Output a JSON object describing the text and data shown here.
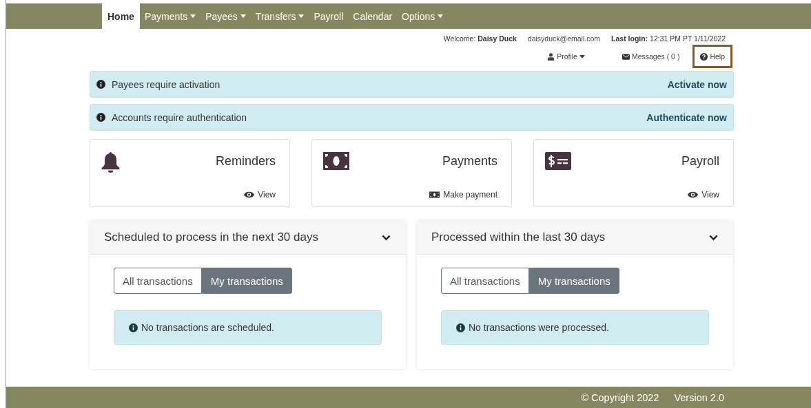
{
  "nav": [
    {
      "label": "Home",
      "selected": true,
      "dropdown": false
    },
    {
      "label": "Payments",
      "selected": false,
      "dropdown": true
    },
    {
      "label": "Payees",
      "selected": false,
      "dropdown": true
    },
    {
      "label": "Transfers",
      "selected": false,
      "dropdown": true
    },
    {
      "label": "Payroll",
      "selected": false,
      "dropdown": false
    },
    {
      "label": "Calendar",
      "selected": false,
      "dropdown": false
    },
    {
      "label": "Options",
      "selected": false,
      "dropdown": true
    }
  ],
  "user_info": {
    "welcome_label": "Welcome:",
    "user_name": "Daisy Duck",
    "email": "daisyduck@email.com",
    "last_login_label": "Last login:",
    "last_login": "12:31 PM PT 1/11/2022"
  },
  "user_menu": [
    {
      "kind": "profile",
      "label": "Profile",
      "dropdown": true,
      "selected": false
    },
    {
      "kind": "messages",
      "label": "Messages ( 0 )",
      "dropdown": false,
      "selected": false
    },
    {
      "kind": "help",
      "label": "Help",
      "dropdown": false,
      "selected": true
    }
  ],
  "alerts": [
    {
      "message": "Payees require activation",
      "action": "Activate now"
    },
    {
      "message": "Accounts require authentication",
      "action": "Authenticate now"
    }
  ],
  "cards": [
    {
      "kind": "bell",
      "title": "Reminders",
      "link": {
        "kind": "view",
        "label": "View"
      }
    },
    {
      "kind": "money",
      "title": "Payments",
      "link": {
        "kind": "money",
        "label": "Make payment"
      }
    },
    {
      "kind": "check",
      "title": "Payroll",
      "link": {
        "kind": "view",
        "label": "View"
      }
    }
  ],
  "panels": [
    {
      "title": "Scheduled to process in the next 30 days",
      "toggles": [
        {
          "label": "All transactions",
          "selected": false
        },
        {
          "label": "My transactions",
          "selected": true
        }
      ],
      "notice": "No transactions are scheduled."
    },
    {
      "title": "Processed within the last 30 days",
      "toggles": [
        {
          "label": "All transactions",
          "selected": false
        },
        {
          "label": "My transactions",
          "selected": true
        }
      ],
      "notice": "No transactions were processed."
    }
  ],
  "footer": {
    "copyright": "© Copyright  2022",
    "version": "Version 2.0"
  }
}
